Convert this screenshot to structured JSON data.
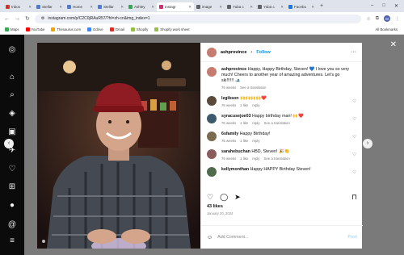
{
  "browser": {
    "tabs": [
      {
        "label": "Inbox",
        "color": "#d93025"
      },
      {
        "label": "Stellar",
        "color": "#4a7bd8"
      },
      {
        "label": "Home",
        "color": "#4a7bd8"
      },
      {
        "label": "Stellar",
        "color": "#4a7bd8"
      },
      {
        "label": "Ashley",
        "color": "#34a853"
      },
      {
        "label": "Instagr",
        "color": "#d62976",
        "active": true
      },
      {
        "label": "image",
        "color": "#5f6368"
      },
      {
        "label": "Yuba c",
        "color": "#5f6368"
      },
      {
        "label": "Yuba c",
        "color": "#5f6368"
      },
      {
        "label": "Facebo",
        "color": "#1877f2"
      }
    ],
    "url": "instagram.com/p/C2C0jRAuR57/?hl=zh-cn&img_index=1",
    "profile_letter": "M",
    "bookmarks": [
      "Maps",
      "YouTube",
      "Thesaurus.com",
      "Gdrive",
      "Gmail",
      "Shopify",
      "Shopify work sheet"
    ],
    "all_bookmarks": "All Bookmarks"
  },
  "post": {
    "username": "ashprovince",
    "follow_label": "Follow",
    "dot": "•",
    "caption": {
      "user": "ashprovince",
      "text": "Happy, Happy Birthday, Steven! 💙 I love you so very much! Cheers to another year of amazing adventures. Let's go ski!!!!!! 🎿",
      "age": "76 weeks",
      "translate": "See a translation"
    },
    "comments": [
      {
        "user": "lzgibson",
        "text": "🙌🙌🙌🙌❤️",
        "age": "76 weeks",
        "likes": "1 like",
        "reply": "reply",
        "translate": "",
        "avatar": "#5b4a3a"
      },
      {
        "user": "syracusejoe03",
        "text": "Happy birthday man! 🙌❤️",
        "age": "76 weeks",
        "likes": "1 like",
        "reply": "reply",
        "translate": "See a translation",
        "avatar": "#3d5a6c"
      },
      {
        "user": "6sfamily",
        "text": "Happy Birthday!",
        "age": "76 weeks",
        "likes": "1 like",
        "reply": "reply",
        "translate": "",
        "avatar": "#7a6a4f"
      },
      {
        "user": "sarahebuchan",
        "text": "HBD, Steven! 🎉👏",
        "age": "76 weeks",
        "likes": "1 like",
        "reply": "reply",
        "translate": "See a translation",
        "avatar": "#8a5c5c"
      },
      {
        "user": "kellymonthan",
        "text": "Happy HAPPY Birthday Steven!",
        "age": "",
        "likes": "",
        "reply": "",
        "translate": "",
        "avatar": "#4f6b4a"
      }
    ],
    "likes": "43 likes",
    "date": "January 20, 2024",
    "add_comment_placeholder": "Add Comment...",
    "post_label": "Post"
  }
}
